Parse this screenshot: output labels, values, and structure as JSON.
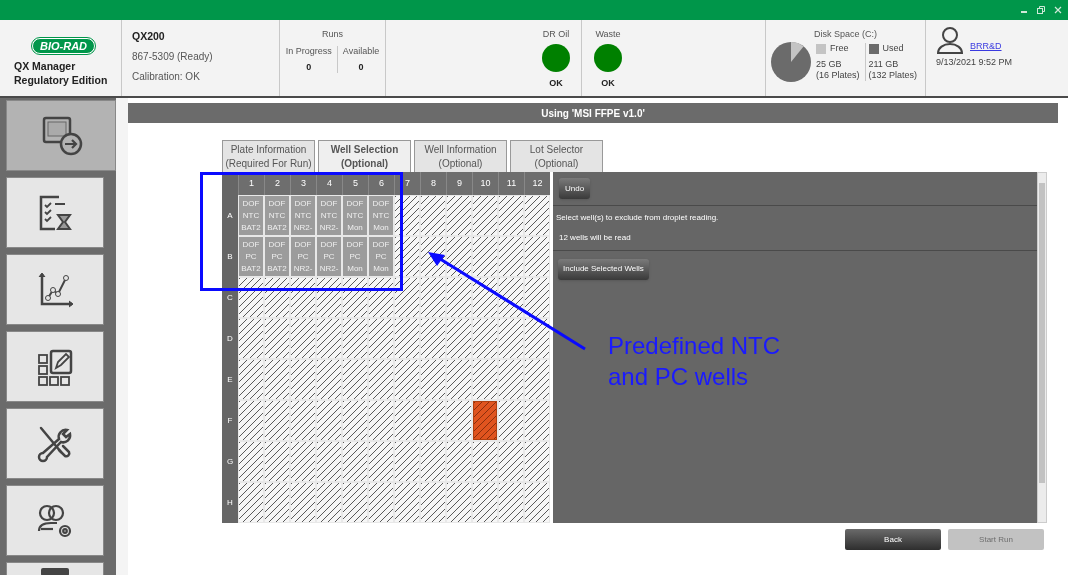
{
  "header": {
    "logo_text": "BIO-RAD",
    "app_name": [
      "QX Manager",
      "Regulatory Edition"
    ],
    "instrument": {
      "name": "QX200",
      "serial": "867-5309 (Ready)",
      "calibration": "Calibration: OK"
    },
    "runs": {
      "title": "Runs",
      "columns": [
        {
          "label": "In Progress",
          "value": "0"
        },
        {
          "label": "Available",
          "value": "0"
        }
      ]
    },
    "indicators": [
      {
        "label": "DR Oil",
        "status": "OK",
        "color": "#008000"
      },
      {
        "label": "Waste",
        "status": "OK",
        "color": "#008000"
      }
    ],
    "disk": {
      "title": "Disk Space (C:)",
      "items": [
        {
          "label": "Free",
          "size": "25 GB",
          "plates": "(16 Plates)",
          "color": "#c4c4c4"
        },
        {
          "label": "Used",
          "size": "211 GB",
          "plates": "(132 Plates)",
          "color": "#6b6b6b"
        }
      ]
    },
    "user": {
      "name": "BRR&D",
      "datetime": "9/13/2021 9:52 PM"
    }
  },
  "sidebar": {
    "items": [
      {
        "kind": "run",
        "selected": true
      },
      {
        "kind": "review",
        "selected": false
      },
      {
        "kind": "analysis",
        "selected": false
      },
      {
        "kind": "templates",
        "selected": false
      },
      {
        "kind": "tools",
        "selected": false
      },
      {
        "kind": "users",
        "selected": false
      },
      {
        "kind": "partial",
        "selected": false
      }
    ]
  },
  "title": "Using 'MSI FFPE v1.0'",
  "tabs": [
    {
      "label": [
        "Plate Information",
        "(Required For Run)"
      ],
      "selected": false
    },
    {
      "label": [
        "Well Selection",
        "(Optional)"
      ],
      "selected": true
    },
    {
      "label": [
        "Well Information",
        "(Optional)"
      ],
      "selected": false
    },
    {
      "label": [
        "Lot Selector",
        "(Optional)"
      ],
      "selected": false
    }
  ],
  "plate": {
    "columns": [
      "1",
      "2",
      "3",
      "4",
      "5",
      "6",
      "7",
      "8",
      "9",
      "10",
      "11",
      "12"
    ],
    "rows": [
      {
        "label": "A",
        "wells": [
          {
            "kind": "defined",
            "selected": false,
            "lines": [
              "DOF",
              "NTC",
              "BAT2"
            ]
          },
          {
            "kind": "defined",
            "selected": false,
            "lines": [
              "DOF",
              "NTC",
              "BAT2"
            ]
          },
          {
            "kind": "defined",
            "selected": false,
            "lines": [
              "DOF",
              "NTC",
              "NR2-"
            ]
          },
          {
            "kind": "defined",
            "selected": false,
            "lines": [
              "DOF",
              "NTC",
              "NR2-"
            ]
          },
          {
            "kind": "defined",
            "selected": false,
            "lines": [
              "DOF",
              "NTC",
              "Mon"
            ]
          },
          {
            "kind": "defined",
            "selected": false,
            "lines": [
              "DOF",
              "NTC",
              "Mon"
            ]
          },
          {
            "kind": "empty",
            "selected": false
          },
          {
            "kind": "empty",
            "selected": false
          },
          {
            "kind": "empty",
            "selected": false
          },
          {
            "kind": "empty",
            "selected": false
          },
          {
            "kind": "empty",
            "selected": false
          },
          {
            "kind": "empty",
            "selected": false
          }
        ]
      },
      {
        "label": "B",
        "wells": [
          {
            "kind": "defined",
            "selected": false,
            "lines": [
              "DOF",
              "PC",
              "BAT2"
            ]
          },
          {
            "kind": "defined",
            "selected": false,
            "lines": [
              "DOF",
              "PC",
              "BAT2"
            ]
          },
          {
            "kind": "defined",
            "selected": false,
            "lines": [
              "DOF",
              "PC",
              "NR2-"
            ]
          },
          {
            "kind": "defined",
            "selected": false,
            "lines": [
              "DOF",
              "PC",
              "NR2-"
            ]
          },
          {
            "kind": "defined",
            "selected": false,
            "lines": [
              "DOF",
              "PC",
              "Mon"
            ]
          },
          {
            "kind": "defined",
            "selected": false,
            "lines": [
              "DOF",
              "PC",
              "Mon"
            ]
          },
          {
            "kind": "empty",
            "selected": false
          },
          {
            "kind": "empty",
            "selected": false
          },
          {
            "kind": "empty",
            "selected": false
          },
          {
            "kind": "empty",
            "selected": false
          },
          {
            "kind": "empty",
            "selected": false
          },
          {
            "kind": "empty",
            "selected": false
          }
        ]
      },
      {
        "label": "C",
        "wells": [
          {
            "kind": "empty",
            "selected": false
          },
          {
            "kind": "empty",
            "selected": false
          },
          {
            "kind": "empty",
            "selected": false
          },
          {
            "kind": "empty",
            "selected": false
          },
          {
            "kind": "empty",
            "selected": false
          },
          {
            "kind": "empty",
            "selected": false
          },
          {
            "kind": "empty",
            "selected": false
          },
          {
            "kind": "empty",
            "selected": false
          },
          {
            "kind": "empty",
            "selected": false
          },
          {
            "kind": "empty",
            "selected": false
          },
          {
            "kind": "empty",
            "selected": false
          },
          {
            "kind": "empty",
            "selected": false
          }
        ]
      },
      {
        "label": "D",
        "wells": [
          {
            "kind": "empty",
            "selected": false
          },
          {
            "kind": "empty",
            "selected": false
          },
          {
            "kind": "empty",
            "selected": false
          },
          {
            "kind": "empty",
            "selected": false
          },
          {
            "kind": "empty",
            "selected": false
          },
          {
            "kind": "empty",
            "selected": false
          },
          {
            "kind": "empty",
            "selected": false
          },
          {
            "kind": "empty",
            "selected": false
          },
          {
            "kind": "empty",
            "selected": false
          },
          {
            "kind": "empty",
            "selected": false
          },
          {
            "kind": "empty",
            "selected": false
          },
          {
            "kind": "empty",
            "selected": false
          }
        ]
      },
      {
        "label": "E",
        "wells": [
          {
            "kind": "empty",
            "selected": false
          },
          {
            "kind": "empty",
            "selected": false
          },
          {
            "kind": "empty",
            "selected": false
          },
          {
            "kind": "empty",
            "selected": false
          },
          {
            "kind": "empty",
            "selected": false
          },
          {
            "kind": "empty",
            "selected": false
          },
          {
            "kind": "empty",
            "selected": false
          },
          {
            "kind": "empty",
            "selected": false
          },
          {
            "kind": "empty",
            "selected": false
          },
          {
            "kind": "empty",
            "selected": false
          },
          {
            "kind": "empty",
            "selected": false
          },
          {
            "kind": "empty",
            "selected": false
          }
        ]
      },
      {
        "label": "F",
        "wells": [
          {
            "kind": "empty",
            "selected": false
          },
          {
            "kind": "empty",
            "selected": false
          },
          {
            "kind": "empty",
            "selected": false
          },
          {
            "kind": "empty",
            "selected": false
          },
          {
            "kind": "empty",
            "selected": false
          },
          {
            "kind": "empty",
            "selected": false
          },
          {
            "kind": "empty",
            "selected": false
          },
          {
            "kind": "empty",
            "selected": false
          },
          {
            "kind": "empty",
            "selected": false
          },
          {
            "kind": "empty",
            "selected": true
          },
          {
            "kind": "empty",
            "selected": false
          },
          {
            "kind": "empty",
            "selected": false
          }
        ]
      },
      {
        "label": "G",
        "wells": [
          {
            "kind": "empty",
            "selected": false
          },
          {
            "kind": "empty",
            "selected": false
          },
          {
            "kind": "empty",
            "selected": false
          },
          {
            "kind": "empty",
            "selected": false
          },
          {
            "kind": "empty",
            "selected": false
          },
          {
            "kind": "empty",
            "selected": false
          },
          {
            "kind": "empty",
            "selected": false
          },
          {
            "kind": "empty",
            "selected": false
          },
          {
            "kind": "empty",
            "selected": false
          },
          {
            "kind": "empty",
            "selected": false
          },
          {
            "kind": "empty",
            "selected": false
          },
          {
            "kind": "empty",
            "selected": false
          }
        ]
      },
      {
        "label": "H",
        "wells": [
          {
            "kind": "empty",
            "selected": false
          },
          {
            "kind": "empty",
            "selected": false
          },
          {
            "kind": "empty",
            "selected": false
          },
          {
            "kind": "empty",
            "selected": false
          },
          {
            "kind": "empty",
            "selected": false
          },
          {
            "kind": "empty",
            "selected": false
          },
          {
            "kind": "empty",
            "selected": false
          },
          {
            "kind": "empty",
            "selected": false
          },
          {
            "kind": "empty",
            "selected": false
          },
          {
            "kind": "empty",
            "selected": false
          },
          {
            "kind": "empty",
            "selected": false
          },
          {
            "kind": "empty",
            "selected": false
          }
        ]
      }
    ]
  },
  "panel": {
    "undo_button": "Undo",
    "instruction": "Select well(s) to exclude from droplet reading.",
    "count": "12 wells will be read",
    "include_button": "Include Selected Wells"
  },
  "buttons": [
    {
      "label": "Back",
      "disabled": false
    },
    {
      "label": "Start Run",
      "disabled": true
    }
  ],
  "annotation": {
    "lines": [
      "Predefined NTC",
      "and PC wells"
    ]
  }
}
